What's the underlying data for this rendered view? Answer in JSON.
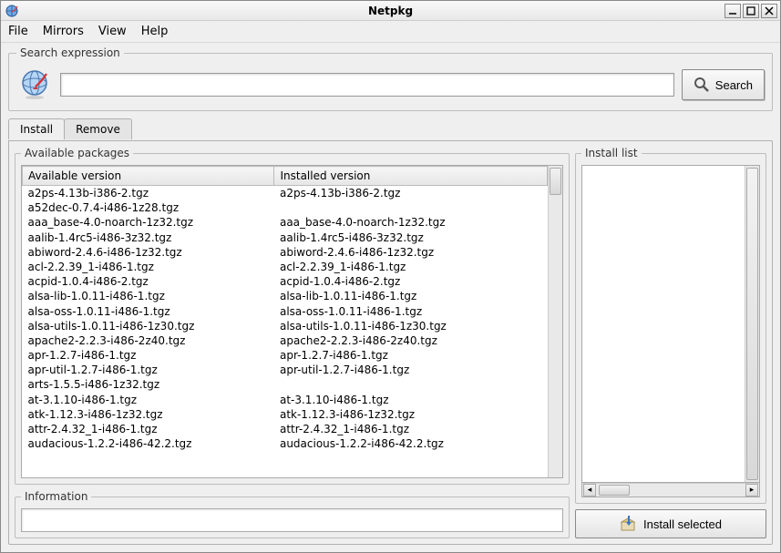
{
  "titlebar": {
    "title": "Netpkg"
  },
  "menubar": {
    "items": [
      "File",
      "Mirrors",
      "View",
      "Help"
    ]
  },
  "search": {
    "legend": "Search expression",
    "value": "",
    "button_label": "Search"
  },
  "tabs": {
    "install": "Install",
    "remove": "Remove"
  },
  "available": {
    "legend": "Available packages",
    "col_available": "Available version",
    "col_installed": "Installed version",
    "rows": [
      {
        "a": "a2ps-4.13b-i386-2.tgz",
        "i": "a2ps-4.13b-i386-2.tgz"
      },
      {
        "a": "a52dec-0.7.4-i486-1z28.tgz",
        "i": ""
      },
      {
        "a": "aaa_base-4.0-noarch-1z32.tgz",
        "i": "aaa_base-4.0-noarch-1z32.tgz"
      },
      {
        "a": "aalib-1.4rc5-i486-3z32.tgz",
        "i": "aalib-1.4rc5-i486-3z32.tgz"
      },
      {
        "a": "abiword-2.4.6-i486-1z32.tgz",
        "i": "abiword-2.4.6-i486-1z32.tgz"
      },
      {
        "a": "acl-2.2.39_1-i486-1.tgz",
        "i": "acl-2.2.39_1-i486-1.tgz"
      },
      {
        "a": "acpid-1.0.4-i486-2.tgz",
        "i": "acpid-1.0.4-i486-2.tgz"
      },
      {
        "a": "alsa-lib-1.0.11-i486-1.tgz",
        "i": "alsa-lib-1.0.11-i486-1.tgz"
      },
      {
        "a": "alsa-oss-1.0.11-i486-1.tgz",
        "i": "alsa-oss-1.0.11-i486-1.tgz"
      },
      {
        "a": "alsa-utils-1.0.11-i486-1z30.tgz",
        "i": "alsa-utils-1.0.11-i486-1z30.tgz"
      },
      {
        "a": "apache2-2.2.3-i486-2z40.tgz",
        "i": "apache2-2.2.3-i486-2z40.tgz"
      },
      {
        "a": "apr-1.2.7-i486-1.tgz",
        "i": "apr-1.2.7-i486-1.tgz"
      },
      {
        "a": "apr-util-1.2.7-i486-1.tgz",
        "i": "apr-util-1.2.7-i486-1.tgz"
      },
      {
        "a": "arts-1.5.5-i486-1z32.tgz",
        "i": ""
      },
      {
        "a": "at-3.1.10-i486-1.tgz",
        "i": "at-3.1.10-i486-1.tgz"
      },
      {
        "a": "atk-1.12.3-i486-1z32.tgz",
        "i": "atk-1.12.3-i486-1z32.tgz"
      },
      {
        "a": "attr-2.4.32_1-i486-1.tgz",
        "i": "attr-2.4.32_1-i486-1.tgz"
      },
      {
        "a": "audacious-1.2.2-i486-42.2.tgz",
        "i": "audacious-1.2.2-i486-42.2.tgz"
      }
    ]
  },
  "info": {
    "legend": "Information"
  },
  "install_list": {
    "legend": "Install list",
    "button_label": "Install selected"
  }
}
